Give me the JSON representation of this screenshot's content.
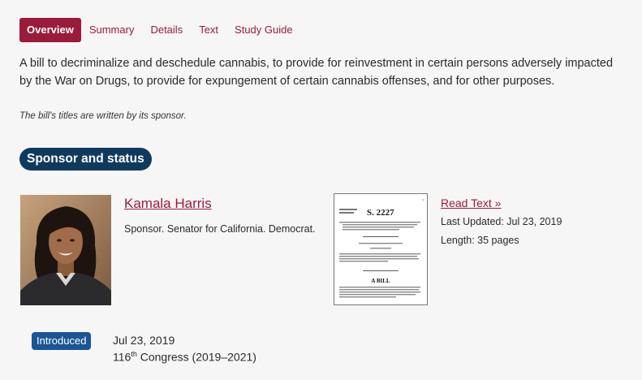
{
  "tabs": [
    {
      "label": "Overview",
      "active": true
    },
    {
      "label": "Summary",
      "active": false
    },
    {
      "label": "Details",
      "active": false
    },
    {
      "label": "Text",
      "active": false
    },
    {
      "label": "Study Guide",
      "active": false
    }
  ],
  "bill": {
    "title": "A bill to decriminalize and deschedule cannabis, to provide for reinvestment in certain persons adversely impacted by the War on Drugs, to provide for expungement of certain cannabis offenses, and for other purposes.",
    "titles_note": "The bill's titles are written by its sponsor."
  },
  "section": {
    "heading": "Sponsor and status"
  },
  "sponsor": {
    "name": "Kamala Harris",
    "description": "Sponsor. Senator for California. Democrat."
  },
  "text_doc": {
    "bill_number": "S. 2227",
    "doc_heading": "A BILL",
    "read_link": "Read Text »",
    "last_updated": "Last Updated: Jul 23, 2019",
    "length": "Length: 35 pages"
  },
  "status": {
    "badge": "Introduced",
    "date": "Jul 23, 2019",
    "congress_num": "116",
    "congress_suffix": "th",
    "congress_rest": " Congress (2019–2021)"
  },
  "colors": {
    "accent": "#9b1b3a",
    "section_pill": "#0f3a5d",
    "badge": "#1a5594",
    "background": "#f6f6f6"
  }
}
